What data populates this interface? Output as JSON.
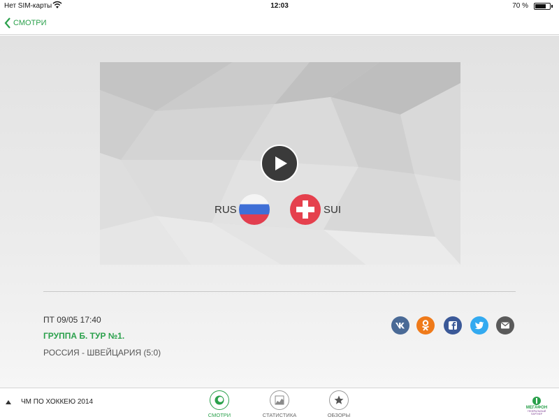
{
  "status_bar": {
    "carrier": "Нет SIM-карты",
    "time": "12:03",
    "battery": "70 %",
    "battery_level": 0.7
  },
  "nav": {
    "back_label": "СМОТРИ"
  },
  "player": {
    "team_home": "RUS",
    "team_away": "SUI",
    "flag_home": "russia-flag",
    "flag_away": "switzerland-flag",
    "play_icon": "play-icon"
  },
  "match": {
    "date": "ПТ 09/05 17:40",
    "group": "ГРУППА Б. ТУР №1.",
    "result": "РОССИЯ - ШВЕЙЦАРИЯ (5:0)"
  },
  "share": [
    {
      "name": "vk-icon",
      "color": "#4a6a96"
    },
    {
      "name": "odnoklassniki-icon",
      "color": "#ef7a1a"
    },
    {
      "name": "facebook-icon",
      "color": "#3b5998"
    },
    {
      "name": "twitter-icon",
      "color": "#33aaf0"
    },
    {
      "name": "mail-icon",
      "color": "#5a5a5a"
    }
  ],
  "tab_bar": {
    "section_label": "ЧМ ПО ХОККЕЮ 2014",
    "tabs": [
      {
        "label": "СМОТРИ",
        "active": true
      },
      {
        "label": "СТАТИСТИКА",
        "active": false
      },
      {
        "label": "ОБЗОРЫ",
        "active": false
      }
    ],
    "logo": {
      "name": "МЕГАФОН",
      "tagline": "ГЕНЕРАЛЬНЫЙ ПАРТНЕР"
    }
  },
  "colors": {
    "accent": "#2aa04b",
    "play_button": "#3a3a3a"
  }
}
